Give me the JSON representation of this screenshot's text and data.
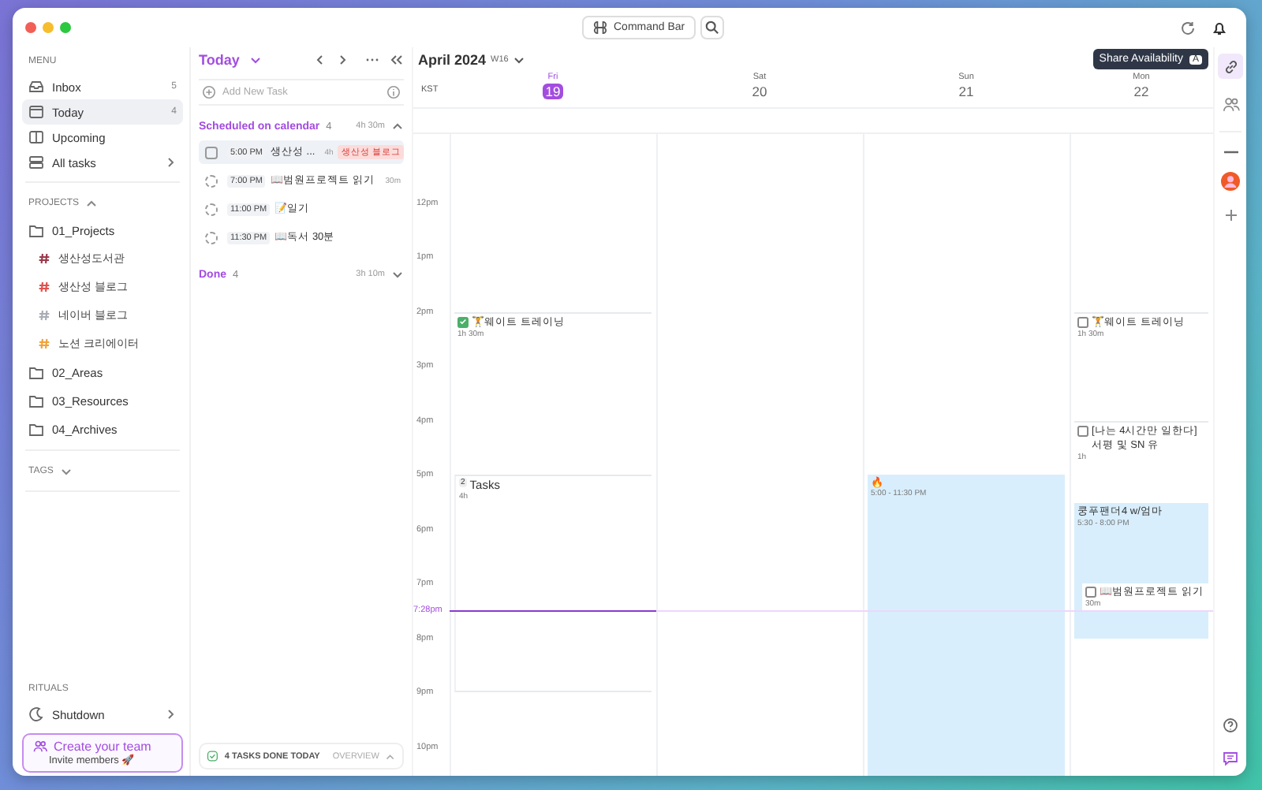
{
  "titlebar": {
    "command_bar": "Command Bar"
  },
  "sidebar": {
    "menu_label": "MENU",
    "menu": [
      {
        "kind": "inbox",
        "label": "Inbox",
        "count": "5",
        "selected": false
      },
      {
        "kind": "today",
        "label": "Today",
        "count": "4",
        "selected": true
      },
      {
        "kind": "upcoming",
        "label": "Upcoming",
        "selected": false
      },
      {
        "kind": "all",
        "label": "All tasks",
        "selected": false
      }
    ],
    "projects_label": "PROJECTS",
    "projects_expanded": true,
    "projects": [
      {
        "label": "01_Projects",
        "children": [
          {
            "label": "생산성도서관",
            "color": "#9a3a4a"
          },
          {
            "label": "생산성 블로그",
            "color": "#e0524f"
          },
          {
            "label": "네이버 블로그",
            "color": "#a8adb5"
          },
          {
            "label": "노션 크리에이터",
            "color": "#f0a33c"
          }
        ]
      },
      {
        "label": "02_Areas"
      },
      {
        "label": "03_Resources"
      },
      {
        "label": "04_Archives"
      }
    ],
    "tags_label": "TAGS",
    "tags_expanded": false,
    "rituals_label": "RITUALS",
    "rituals": [
      {
        "label": "Shutdown"
      }
    ],
    "team_card": {
      "title": "Create your team",
      "subtitle": "Invite members 🚀"
    }
  },
  "tasks": {
    "title": "Today",
    "add_placeholder": "Add New Task",
    "sections": [
      {
        "title": "Scheduled on calendar",
        "count": "4",
        "duration": "4h 30m",
        "expanded": true,
        "items": [
          {
            "kind": "task",
            "time": "5:00 PM",
            "title": "생산성 ...",
            "duration": "4h",
            "tag": "생산성 블로그",
            "selected": true
          },
          {
            "kind": "recurring",
            "time": "7:00 PM",
            "title": "📖범원프로젝트 읽기",
            "duration": "30m",
            "selected": false
          },
          {
            "kind": "recurring",
            "time": "11:00 PM",
            "title": "📝일기",
            "selected": false
          },
          {
            "kind": "recurring",
            "time": "11:30 PM",
            "title": "📖독서 30분",
            "selected": false
          }
        ]
      },
      {
        "title": "Done",
        "count": "4",
        "duration": "3h 10m",
        "expanded": false
      }
    ],
    "footer": {
      "label": "4 TASKS DONE TODAY",
      "link": "OVERVIEW"
    }
  },
  "calendar": {
    "month": "April 2024",
    "week": "W16",
    "timezone": "KST",
    "days": [
      {
        "name": "Fri",
        "date": "19",
        "today": true,
        "events": [
          {
            "kind": "task",
            "title": "🏋️웨이트 트레이닝",
            "sub": "1h 30m",
            "checked": true
          },
          {
            "kind": "group",
            "count": "2",
            "title": "Tasks",
            "sub": "4h"
          }
        ]
      },
      {
        "name": "Sat",
        "date": "20",
        "today": false
      },
      {
        "name": "Sun",
        "date": "21",
        "today": false,
        "events": [
          {
            "kind": "event",
            "title": "🔥",
            "sub": "5:00 - 11:30 PM"
          }
        ]
      },
      {
        "name": "Mon",
        "date": "22",
        "today": false,
        "events": [
          {
            "kind": "task",
            "title": "🏋️웨이트 트레이닝",
            "sub": "1h 30m",
            "checked": false
          },
          {
            "kind": "task",
            "title": "[나는 4시간만 일한다] 서평 및 SN 유",
            "sub": "1h",
            "checked": false
          },
          {
            "kind": "event",
            "title": "쿵푸팬더4 w/엄마",
            "sub": "5:30 - 8:00 PM",
            "inner": {
              "title": "📖범원프로젝트 읽기",
              "sub": "30m",
              "checked": false
            }
          }
        ]
      }
    ],
    "hours": [
      "12pm",
      "1pm",
      "2pm",
      "3pm",
      "4pm",
      "5pm",
      "6pm",
      "7pm",
      "8pm",
      "9pm",
      "10pm"
    ],
    "now": "7:28pm"
  },
  "tooltip": {
    "label": "Share Availability",
    "key": "A"
  }
}
